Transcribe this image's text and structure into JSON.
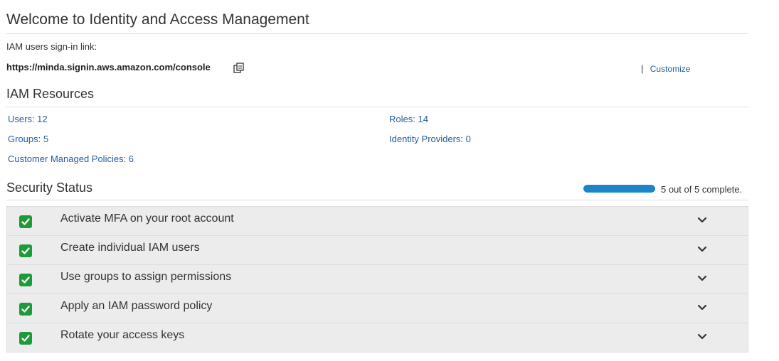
{
  "header": {
    "title": "Welcome to Identity and Access Management"
  },
  "signin": {
    "label": "IAM users sign-in link:",
    "url": "https://minda.signin.aws.amazon.com/console",
    "separator": "|",
    "customize_label": "Customize",
    "copy_icon": "copy-icon"
  },
  "resources": {
    "title": "IAM Resources",
    "users": "Users: 12",
    "groups": "Groups: 5",
    "customer_managed_policies": "Customer Managed Policies: 6",
    "roles": "Roles: 14",
    "identity_providers": "Identity Providers: 0"
  },
  "security_status": {
    "title": "Security Status",
    "progress_fraction": 1.0,
    "progress_text": "5 out of 5 complete.",
    "items": [
      {
        "label": "Activate MFA on your root account",
        "icon": "check-icon"
      },
      {
        "label": "Create individual IAM users",
        "icon": "check-icon"
      },
      {
        "label": "Use groups to assign permissions",
        "icon": "check-icon"
      },
      {
        "label": "Apply an IAM password policy",
        "icon": "check-icon"
      },
      {
        "label": "Rotate your access keys",
        "icon": "check-icon"
      }
    ]
  },
  "colors": {
    "link": "#24609e",
    "progress": "#1a86c8",
    "check": "#1e9a3a",
    "status_bg": "#ececec"
  }
}
